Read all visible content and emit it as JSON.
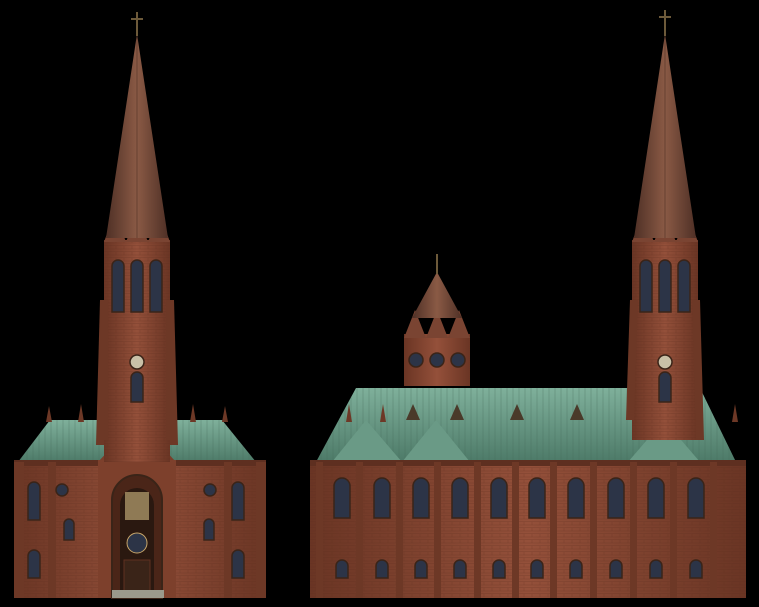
{
  "scene": {
    "background": "#000000",
    "subjects": [
      {
        "label": "church-front-elevation"
      },
      {
        "label": "church-side-elevation"
      }
    ]
  },
  "colors": {
    "brick": "#8a4a33",
    "brick_dark": "#5e2f20",
    "brick_light": "#a65c3f",
    "copper_roof": "#6fa08c",
    "copper_roof_dark": "#4d7a68",
    "spire_slate": "#7a5140",
    "spire_dark": "#4f3026",
    "window": "#2c3447",
    "window_frame": "#3a2418",
    "gilt": "#c8a66a"
  }
}
